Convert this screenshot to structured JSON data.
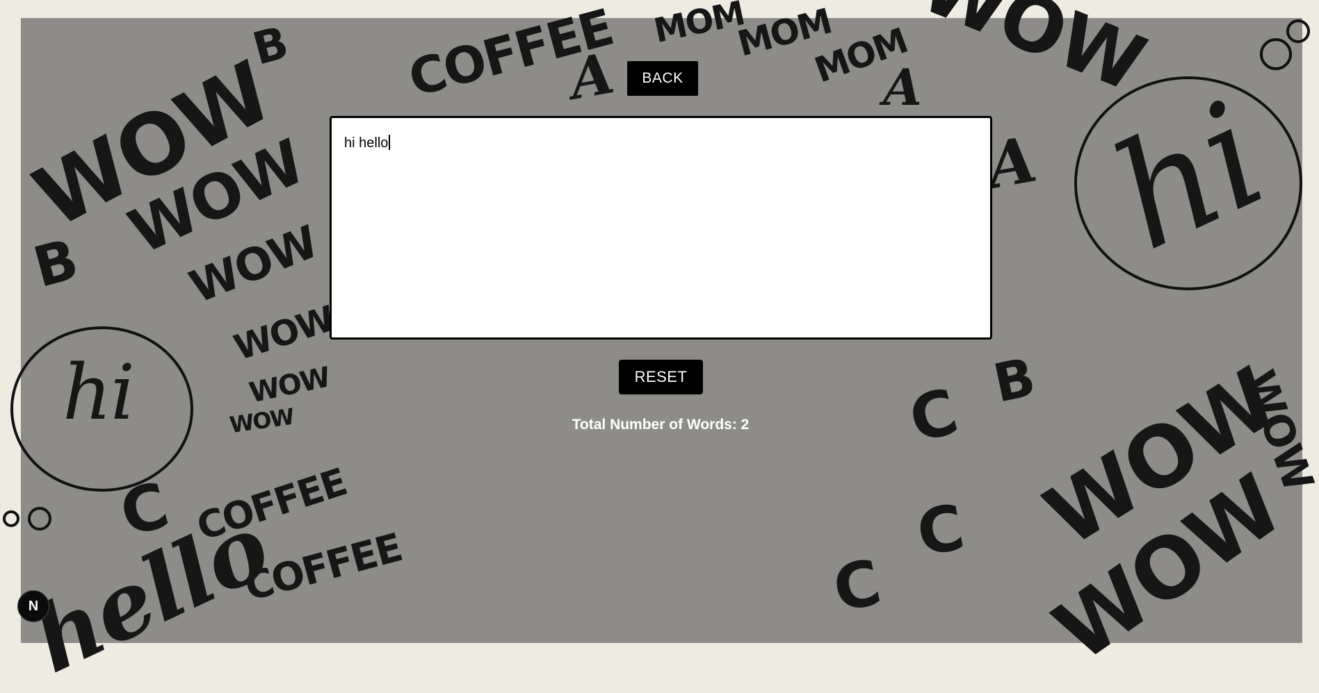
{
  "toolbar": {
    "back_label": "BACK"
  },
  "editor": {
    "text": "hi hello"
  },
  "actions": {
    "reset_label": "RESET"
  },
  "stats": {
    "word_count_text": "Total Number of Words: 2"
  },
  "badge": {
    "letter": "N"
  },
  "background": {
    "doodle_words": [
      "WOW",
      "COFFEE",
      "MOM",
      "hi",
      "hello",
      "B",
      "C",
      "A"
    ]
  },
  "colors": {
    "page_bg": "#eeebe1",
    "stage_bg": "#8d8c89",
    "button_bg": "#000000",
    "button_text": "#ffffff"
  }
}
